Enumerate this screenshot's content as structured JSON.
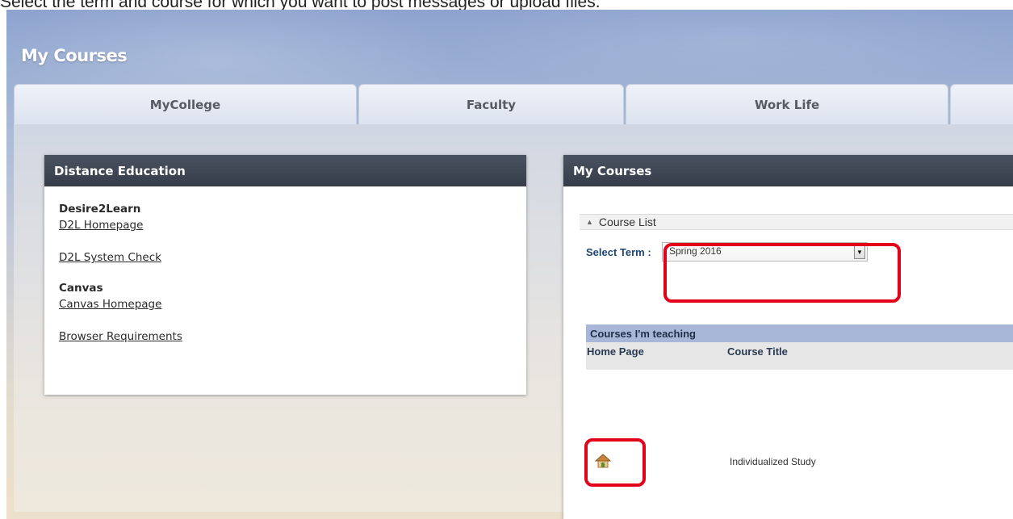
{
  "instruction": "Select the term and course for which you want to post messages or upload files.",
  "portal": {
    "title": "My Courses",
    "tabs": [
      {
        "label": "MyCollege"
      },
      {
        "label": "Faculty"
      },
      {
        "label": "Work Life"
      },
      {
        "label": ""
      }
    ]
  },
  "distance_education": {
    "title": "Distance Education",
    "sections": [
      {
        "heading": "Desire2Learn",
        "links": [
          "D2L Homepage",
          "D2L System Check"
        ]
      },
      {
        "heading": "Canvas",
        "links": [
          "Canvas Homepage",
          "Browser Requirements"
        ]
      }
    ]
  },
  "my_courses": {
    "title": "My Courses",
    "course_list_label": "Course List",
    "select_term_label": "Select Term :",
    "selected_term": "Spring 2016",
    "teaching_header": "Courses I'm teaching",
    "columns": {
      "home_page": "Home Page",
      "course_title": "Course Title"
    },
    "courses": [
      {
        "title": "Individualized Study",
        "home_icon": "home-icon"
      }
    ]
  },
  "highlight_color": "#e3001b"
}
